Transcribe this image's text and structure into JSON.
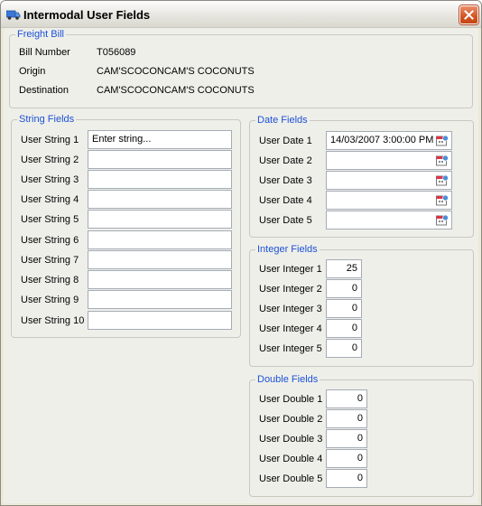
{
  "window": {
    "title": "Intermodal User Fields"
  },
  "colors": {
    "group_title": "#1c52d6",
    "close_button": "#d15424"
  },
  "icons": {
    "app": "truck-icon",
    "close": "close-icon",
    "calendar": "calendar-icon"
  },
  "freight_bill": {
    "title": "Freight Bill",
    "rows": [
      {
        "label": "Bill Number",
        "value": "T056089"
      },
      {
        "label": "Origin",
        "value": "CAM'SCOCONCAM'S COCONUTS"
      },
      {
        "label": "Destination",
        "value": "CAM'SCOCONCAM'S COCONUTS"
      }
    ]
  },
  "string_fields": {
    "title": "String Fields",
    "items": [
      {
        "label": "User String 1",
        "value": "Enter string..."
      },
      {
        "label": "User String 2",
        "value": ""
      },
      {
        "label": "User String 3",
        "value": ""
      },
      {
        "label": "User String 4",
        "value": ""
      },
      {
        "label": "User String 5",
        "value": ""
      },
      {
        "label": "User String 6",
        "value": ""
      },
      {
        "label": "User String 7",
        "value": ""
      },
      {
        "label": "User String 8",
        "value": ""
      },
      {
        "label": "User String 9",
        "value": ""
      },
      {
        "label": "User String 10",
        "value": ""
      }
    ]
  },
  "date_fields": {
    "title": "Date Fields",
    "items": [
      {
        "label": "User Date 1",
        "value": "14/03/2007 3:00:00 PM"
      },
      {
        "label": "User Date 2",
        "value": ""
      },
      {
        "label": "User Date 3",
        "value": ""
      },
      {
        "label": "User Date 4",
        "value": ""
      },
      {
        "label": "User Date 5",
        "value": ""
      }
    ]
  },
  "integer_fields": {
    "title": "Integer Fields",
    "items": [
      {
        "label": "User Integer 1",
        "value": "25"
      },
      {
        "label": "User Integer 2",
        "value": "0"
      },
      {
        "label": "User Integer 3",
        "value": "0"
      },
      {
        "label": "User Integer 4",
        "value": "0"
      },
      {
        "label": "User Integer 5",
        "value": "0"
      }
    ]
  },
  "double_fields": {
    "title": "Double Fields",
    "items": [
      {
        "label": "User Double 1",
        "value": "0"
      },
      {
        "label": "User Double 2",
        "value": "0"
      },
      {
        "label": "User Double 3",
        "value": "0"
      },
      {
        "label": "User Double 4",
        "value": "0"
      },
      {
        "label": "User Double 5",
        "value": "0"
      }
    ]
  }
}
